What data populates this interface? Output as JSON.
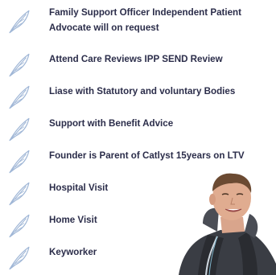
{
  "services": [
    {
      "label_line1": "Family Support Officer Independent Patient",
      "label_line2": "Advocate will on request",
      "icon": "feather-icon"
    },
    {
      "label_line1": "Attend Care Reviews IPP SEND Review",
      "icon": "feather-icon"
    },
    {
      "label_line1": "Liase with Statutory and voluntary Bodies",
      "icon": "feather-icon"
    },
    {
      "label_line1": "Support with Benefit Advice",
      "icon": "feather-icon"
    },
    {
      "label_line1": "Founder is Parent of Catlyst  15years on LTV",
      "icon": "feather-icon"
    },
    {
      "label_line1": "Hospital Visit",
      "icon": "feather-icon"
    },
    {
      "label_line1": "Home Visit",
      "icon": "feather-icon"
    },
    {
      "label_line1": "Keyworker",
      "icon": "feather-icon"
    }
  ],
  "colors": {
    "text": "#2b2d4a",
    "feather": "#9fb6d6",
    "background": "#ffffff"
  }
}
